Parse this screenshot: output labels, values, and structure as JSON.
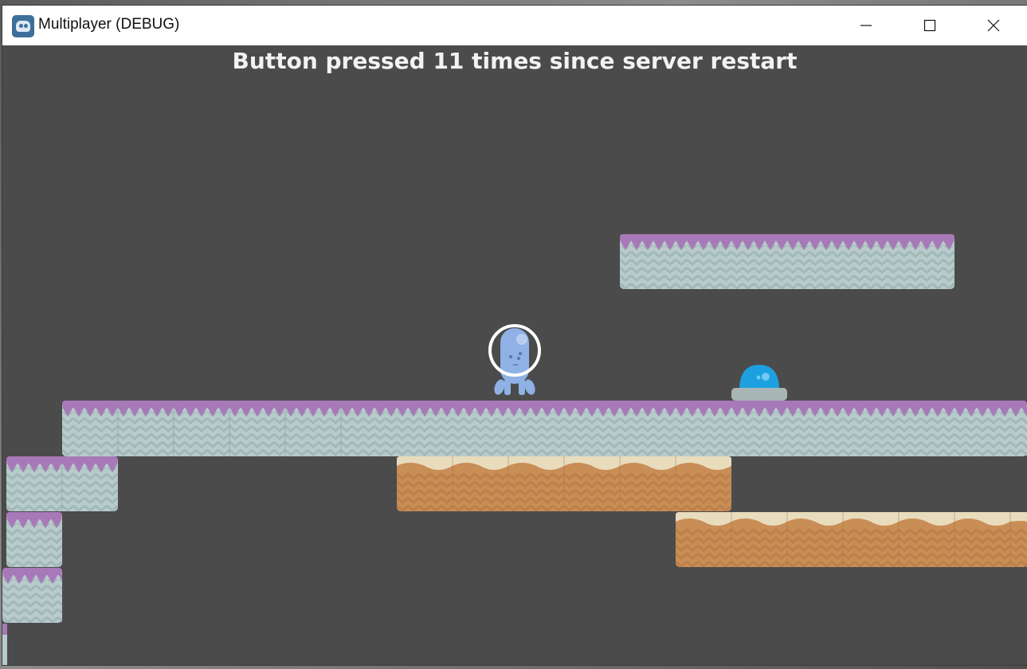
{
  "window": {
    "title": "Multiplayer (DEBUG)",
    "icon": "godot-engine-icon",
    "controls": [
      "minimize-icon",
      "maximize-icon",
      "close-icon"
    ]
  },
  "hud": {
    "counter_text": "Button pressed 11 times since server restart"
  },
  "colors": {
    "game_background": "#4b4b4b",
    "ice_top": "#a879b8",
    "ice_body": "#b7cbcb",
    "sand_top": "#e8dcbd",
    "sand_body": "#c98d56",
    "player": "#8fb1e6",
    "button_dome": "#1da0e0",
    "button_base": "#a8b5b5"
  }
}
